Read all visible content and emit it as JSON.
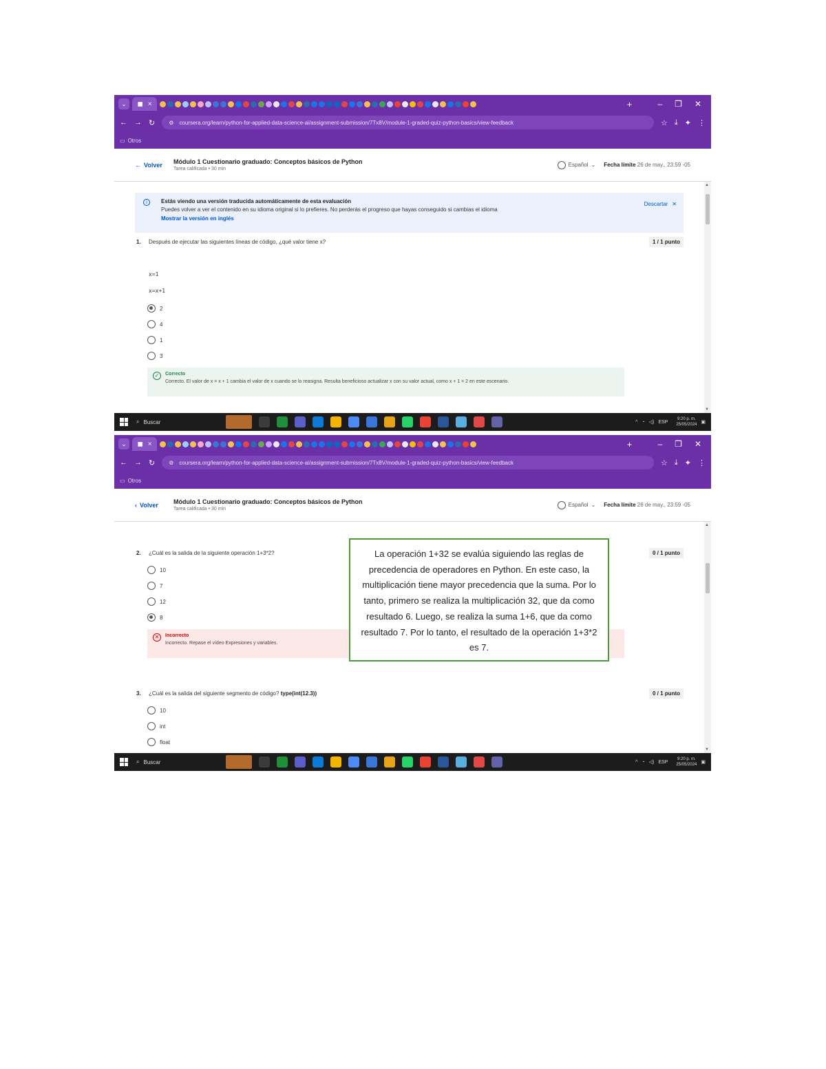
{
  "browser": {
    "url": "coursera.org/learn/python-for-applied-data-science-ai/assignment-submission/7Tx8V/module-1-graded-quiz-python-basics/view-feedback",
    "bookmarks_label": "Otros",
    "new_tab": "+",
    "min": "–",
    "restore": "❐",
    "close": "✕"
  },
  "header": {
    "back_label": "Volver",
    "title": "Módulo 1 Cuestionario graduado: Conceptos básicos de Python",
    "subtitle": "Tarea calificada • 30 min",
    "language": "Español",
    "due_label": "Fecha límite",
    "due_value": "26 de may., 23:59 -05"
  },
  "banner": {
    "heading": "Estás viendo una versión traducida automáticamente de esta evaluación",
    "body": "Puedes volver a ver el contenido en su idioma original si lo prefieres. No perderás el progreso que hayas conseguido si cambias el idioma",
    "link": "Mostrar la versión en inglés",
    "dismiss": "Descartar"
  },
  "q1": {
    "number": "1.",
    "text": "Después de ejecutar las siguientes líneas de código, ¿qué valor tiene x?",
    "points": "1 / 1 punto",
    "code": [
      "x=1",
      "x=x+1"
    ],
    "options": [
      "2",
      "4",
      "1",
      "3"
    ],
    "selected": 0,
    "feedback_title": "Correcto",
    "feedback_body": "Correcto. El valor de x = x + 1 cambia el valor de x cuando se lo reasigna. Resulta beneficioso actualizar x con su valor actual, como x + 1 = 2 en este escenario."
  },
  "q2": {
    "number": "2.",
    "text": "¿Cuál es la salida de la siguiente operación 1+3*2?",
    "points": "0 / 1 punto",
    "options": [
      "10",
      "7",
      "12",
      "8"
    ],
    "selected": 3,
    "feedback_title": "Incorrecto",
    "feedback_body": "Incorrecto. Repase el vídeo Expresiones y variables."
  },
  "q3": {
    "number": "3.",
    "text": "¿Cuál es la salida del siguiente segmento de código?",
    "code_inline": "type(int(12.3))",
    "points": "0 / 1 punto",
    "options": [
      "10",
      "int",
      "float"
    ]
  },
  "taskbar": {
    "search": "Buscar",
    "lang": "ESP",
    "time": "9:20 p. m.",
    "date": "25/05/2024"
  },
  "note": {
    "text": "La operación 1+32 se evalúa siguiendo las reglas de precedencia de operadores en Python. En este caso, la multiplicación tiene mayor precedencia que la suma. Por lo tanto, primero se realiza la multiplicación 32, que da como resultado 6. Luego, se realiza la suma 1+6, que da como resultado 7. Por lo tanto, el resultado de la operación 1+3*2 es 7."
  },
  "colors": {
    "chrome": "#6b2fa8",
    "link": "#0056d2",
    "correct": "#1f8354",
    "incorrect": "#d30001",
    "note_border": "#4a9a35"
  }
}
